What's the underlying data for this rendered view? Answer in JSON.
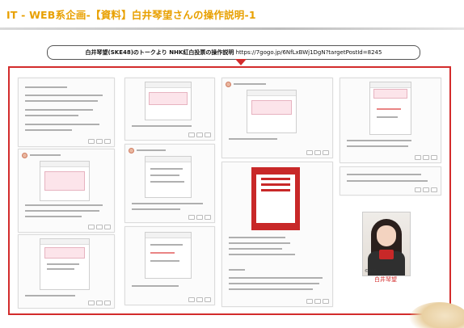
{
  "slide": {
    "title": "IT - WEB系企画-【資料】白井琴望さんの操作説明-1",
    "caption_bold": "白井琴望(SKE48)のトークより NHK紅白投票の操作説明",
    "caption_url": "https://7gogo.jp/6NfLxBWj1DgN?targetPostId=8245",
    "photo_label": "白井琴望",
    "photo_copyright": "©AKS"
  },
  "colors": {
    "title": "#e8a000",
    "frame": "#d32c2c",
    "arrow": "#d32c2c"
  }
}
